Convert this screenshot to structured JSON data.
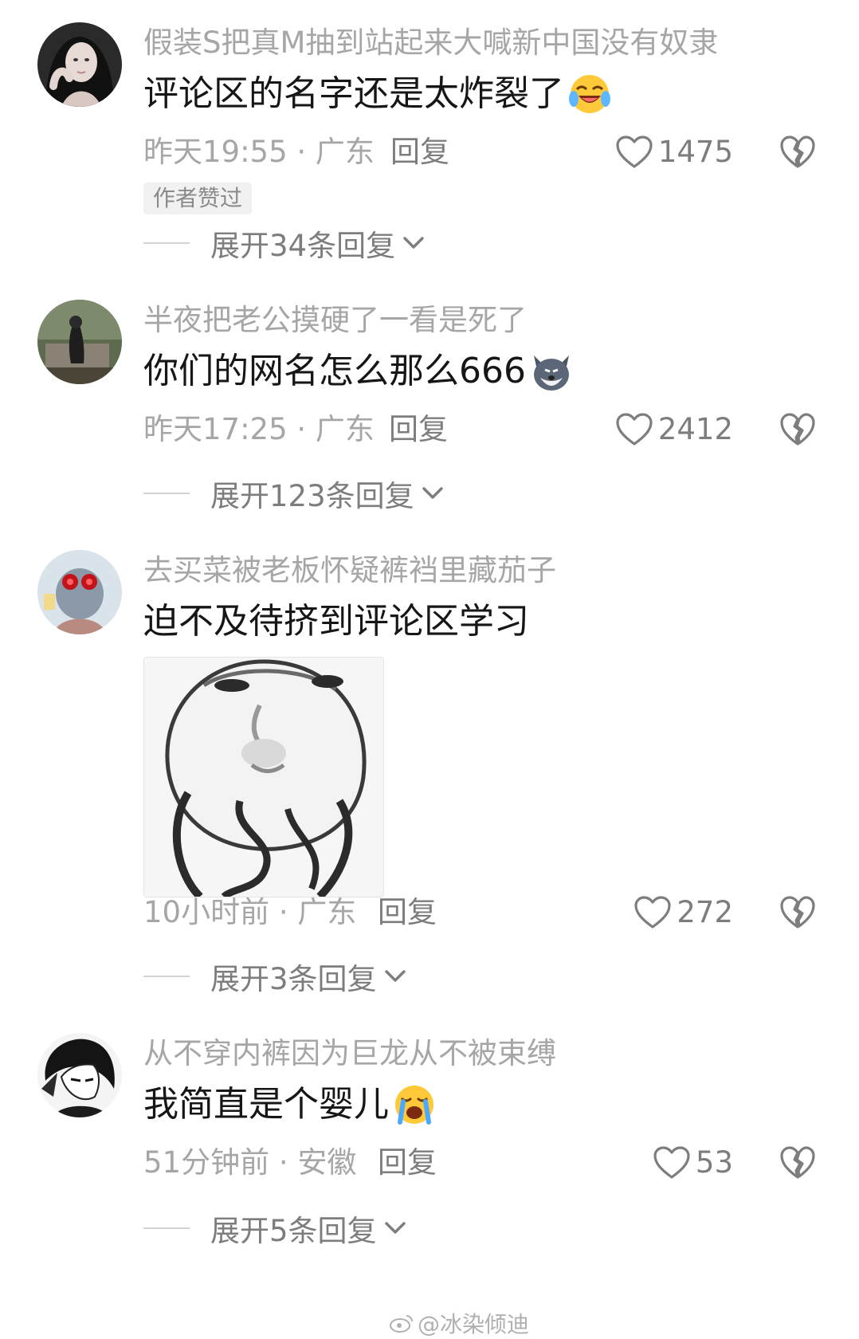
{
  "comments": [
    {
      "username": "假装S把真M抽到站起来大喊新中国没有奴隶",
      "content": "评论区的名字还是太炸裂了",
      "emoji": "laughing-tears-emoji",
      "time": "昨天19:55 · 广东",
      "reply_label": "回复",
      "likes": "1475",
      "badge": "作者赞过",
      "expand": "展开34条回复"
    },
    {
      "username": "半夜把老公摸硬了一看是死了",
      "content": "你们的网名怎么那么666",
      "emoji": "husky-emoji",
      "time": "昨天17:25 · 广东",
      "reply_label": "回复",
      "likes": "2412",
      "expand": "展开123条回复"
    },
    {
      "username": "去买菜被老板怀疑裤裆里藏茄子",
      "content": "迫不及待挤到评论区学习",
      "sticker": "meme-face-sticker",
      "time": "10小时前 · 广东",
      "reply_label": "回复",
      "likes": "272",
      "expand": "展开3条回复"
    },
    {
      "username": "从不穿内裤因为巨龙从不被束缚",
      "content": "我简直是个婴儿",
      "emoji": "crying-emoji",
      "time": "51分钟前 · 安徽",
      "reply_label": "回复",
      "likes": "53",
      "expand": "展开5条回复"
    }
  ],
  "watermark": "@冰染倾迪",
  "colors": {
    "text": "#161616",
    "secondary": "#a6a6a6",
    "action": "#7d7d7d"
  }
}
